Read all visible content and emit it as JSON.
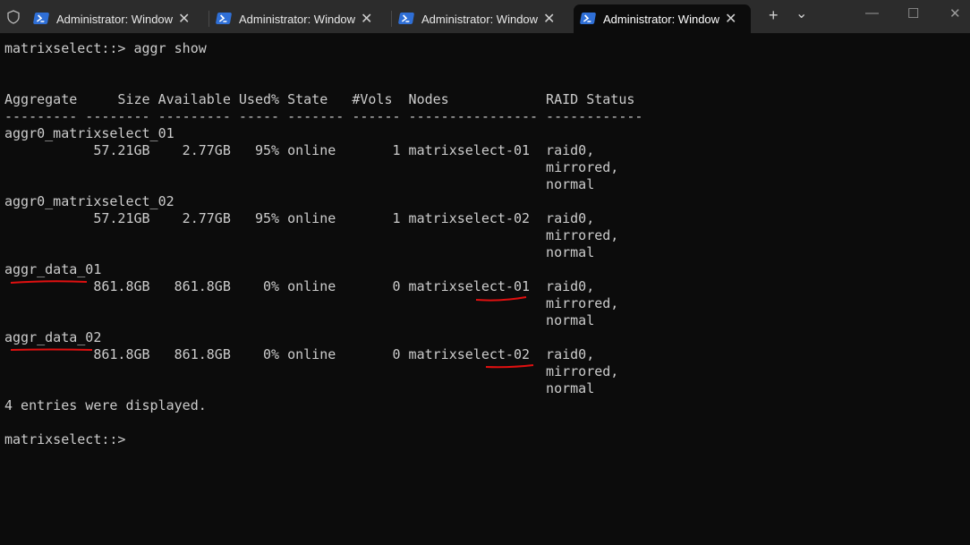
{
  "tabs": [
    {
      "title": "Administrator: Windows PowerShell",
      "active": false
    },
    {
      "title": "Administrator: Windows PowerShell",
      "active": false
    },
    {
      "title": "Administrator: Windows PowerShell",
      "active": false
    },
    {
      "title": "Administrator: Windows PowerShell",
      "active": true
    }
  ],
  "tabbar": {
    "new_tab": "+",
    "dropdown": "⌄",
    "minimize": "—",
    "maximize": "☐",
    "close": "✕",
    "tab_close": "✕"
  },
  "terminal": {
    "lines": [
      "matrixselect::> aggr show",
      "",
      "",
      "Aggregate     Size Available Used% State   #Vols  Nodes            RAID Status",
      "--------- -------- --------- ----- ------- ------ ---------------- ------------",
      "aggr0_matrixselect_01",
      "           57.21GB    2.77GB   95% online       1 matrixselect-01  raid0,",
      "                                                                   mirrored,",
      "                                                                   normal",
      "aggr0_matrixselect_02",
      "           57.21GB    2.77GB   95% online       1 matrixselect-02  raid0,",
      "                                                                   mirrored,",
      "                                                                   normal",
      "aggr_data_01",
      "           861.8GB   861.8GB    0% online       0 matrixselect-01  raid0,",
      "                                                                   mirrored,",
      "                                                                   normal",
      "aggr_data_02",
      "           861.8GB   861.8GB    0% online       0 matrixselect-02  raid0,",
      "                                                                   mirrored,",
      "                                                                   normal",
      "4 entries were displayed.",
      "",
      "matrixselect::> "
    ]
  },
  "annotation_color": "#e01010"
}
